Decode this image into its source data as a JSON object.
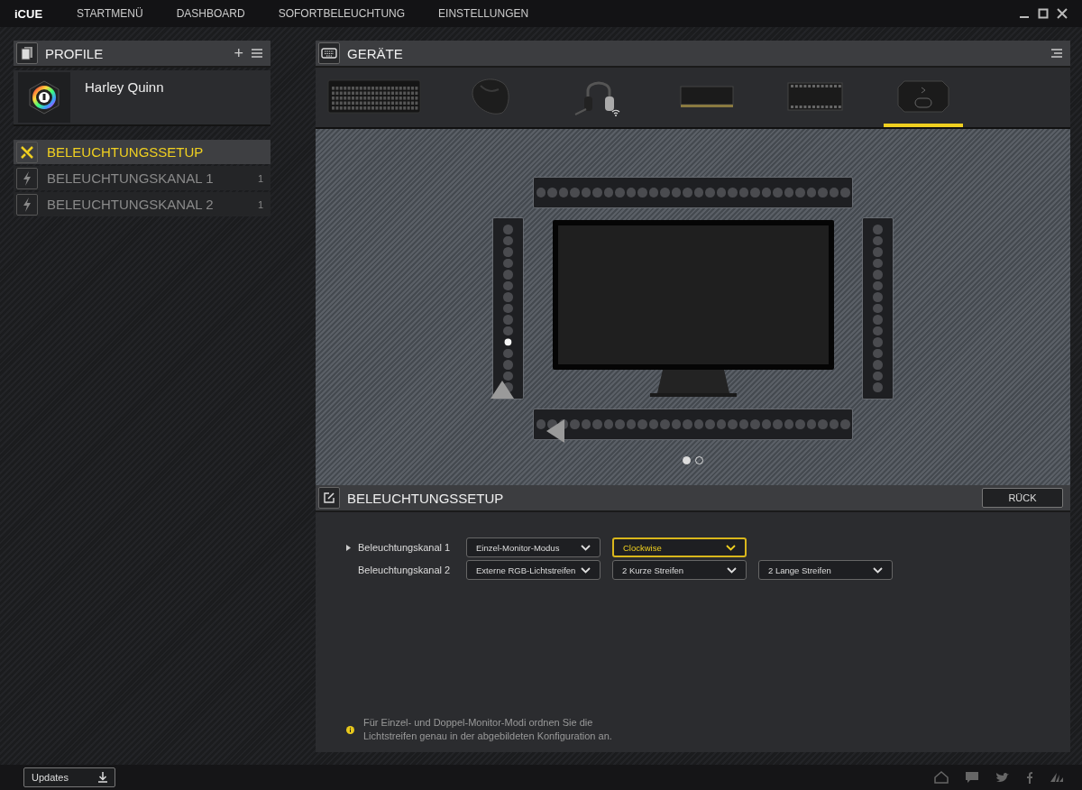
{
  "app": {
    "logo": "iCUE"
  },
  "nav": [
    {
      "label": "STARTMENÜ"
    },
    {
      "label": "DASHBOARD"
    },
    {
      "label": "SOFORTBELEUCHTUNG"
    },
    {
      "label": "EINSTELLUNGEN"
    }
  ],
  "profiles": {
    "title": "PROFILE",
    "add": "+",
    "profile_name": "Harley Quinn"
  },
  "sidebar": {
    "items": [
      {
        "kind": "setup",
        "label": "BELEUCHTUNGSSETUP",
        "selected": true
      },
      {
        "kind": "channel",
        "label": "BELEUCHTUNGSKANAL 1",
        "count": "1",
        "selected": false
      },
      {
        "kind": "channel",
        "label": "BELEUCHTUNGSKANAL 2",
        "count": "1",
        "selected": false
      }
    ]
  },
  "devices": {
    "title": "GERÄTE",
    "items": [
      {
        "kind": "keyboard",
        "selected": false,
        "wireless": false
      },
      {
        "kind": "mouse",
        "selected": false,
        "wireless": false
      },
      {
        "kind": "headset",
        "selected": false,
        "wireless": true
      },
      {
        "kind": "memory",
        "selected": false,
        "wireless": false
      },
      {
        "kind": "hub",
        "selected": false,
        "wireless": false
      },
      {
        "kind": "controller",
        "selected": true,
        "wireless": false
      }
    ]
  },
  "layout_preview": {
    "strips": [
      {
        "kind": "top",
        "start_marker": false,
        "leds": [
          false,
          false,
          false,
          false,
          false,
          false,
          false,
          false,
          false,
          false,
          false,
          false,
          false,
          false,
          false,
          false,
          false,
          false,
          false,
          false,
          false,
          false,
          false,
          false,
          false,
          false,
          false,
          false
        ]
      },
      {
        "kind": "left",
        "start_marker": true,
        "leds": [
          false,
          false,
          false,
          false,
          false,
          false,
          false,
          false,
          false,
          false,
          true,
          false,
          false,
          false,
          false
        ]
      },
      {
        "kind": "right",
        "start_marker": false,
        "leds": [
          false,
          false,
          false,
          false,
          false,
          false,
          false,
          false,
          false,
          false,
          false,
          false,
          false,
          false,
          false
        ]
      },
      {
        "kind": "bottom",
        "start_marker": true,
        "leds": [
          false,
          false,
          false,
          false,
          false,
          false,
          false,
          false,
          false,
          false,
          false,
          false,
          false,
          false,
          false,
          false,
          false,
          false,
          false,
          false,
          false,
          false,
          false,
          false,
          false,
          false,
          false,
          false
        ]
      }
    ],
    "pages": [
      {
        "selected": true
      },
      {
        "selected": false
      }
    ]
  },
  "setup": {
    "title": "BELEUCHTUNGSSETUP",
    "back_button": "RÜCK",
    "rows": [
      {
        "label": "Beleuchtungskanal 1",
        "selected": true,
        "dropdowns": [
          {
            "value": "Einzel-Monitor-Modus",
            "highlighted": false
          },
          {
            "value": "Clockwise",
            "highlighted": true
          }
        ]
      },
      {
        "label": "Beleuchtungskanal 2",
        "selected": false,
        "dropdowns": [
          {
            "value": "Externe RGB-Lichtstreifen",
            "highlighted": false
          },
          {
            "value": "2 Kurze Streifen",
            "highlighted": false
          },
          {
            "value": "2 Lange Streifen",
            "highlighted": false
          }
        ]
      }
    ],
    "note": "Für Einzel- und Doppel-Monitor-Modi ordnen Sie die Lichtstreifen genau in der abgebildeten Konfiguration an."
  },
  "status_bar": {
    "updates_button": "Updates"
  }
}
